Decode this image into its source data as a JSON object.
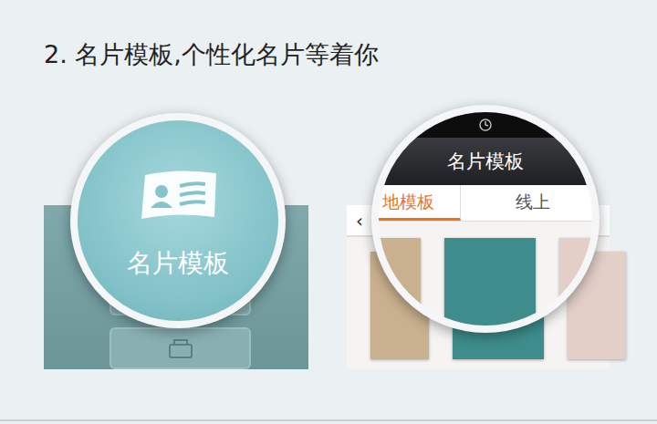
{
  "title": "2. 名片模板,个性化名片等着你",
  "left_panel": {
    "label": "名片模板"
  },
  "right_panel": {
    "back": "‹",
    "header": "名片模板",
    "tabs": [
      {
        "label": "地模板",
        "selected": true
      },
      {
        "label": "线上",
        "selected": false
      }
    ],
    "templates": [
      {
        "color": "#c9b08e"
      },
      {
        "color": "#3e8c8c"
      },
      {
        "color": "#e3cfc8"
      }
    ]
  }
}
